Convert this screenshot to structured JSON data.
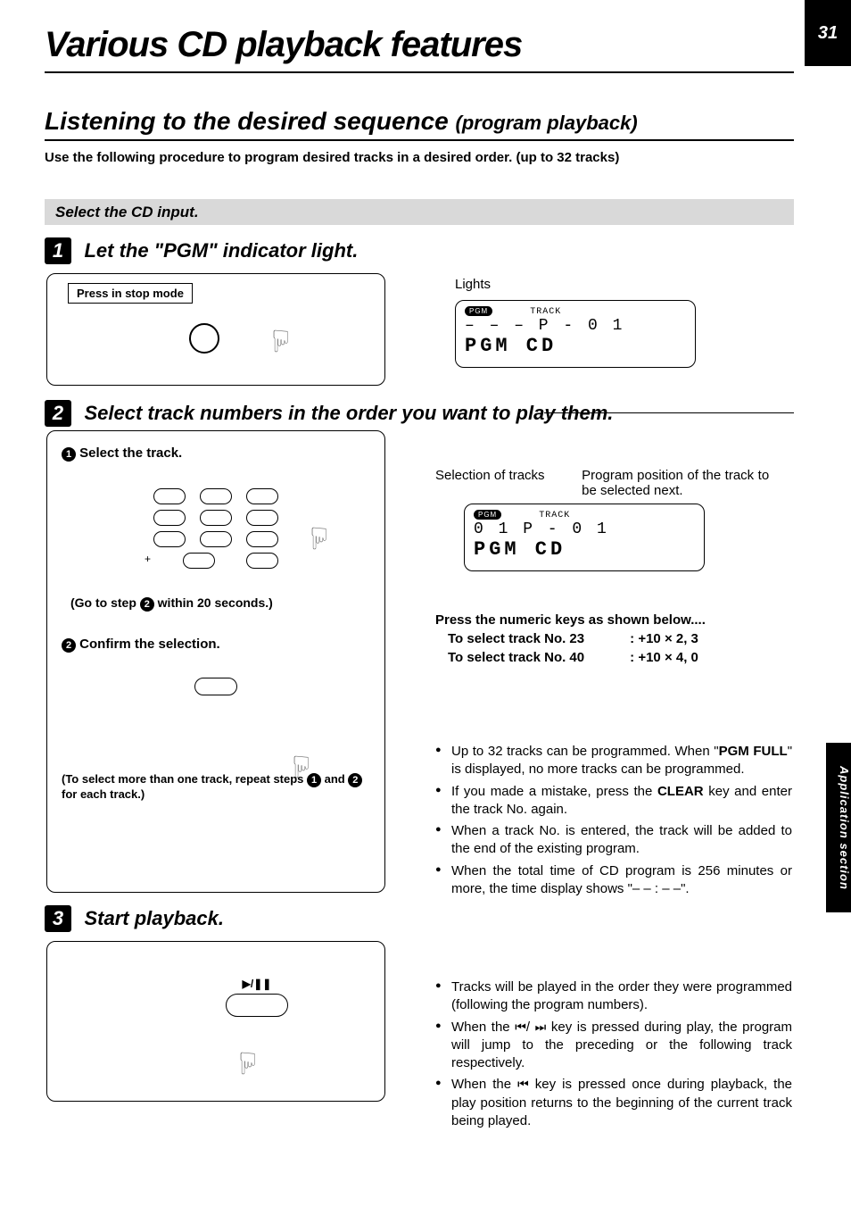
{
  "page_number": "31",
  "side_tab": "Application section",
  "page_title": "Various CD playback features",
  "section_title_main": "Listening to the desired sequence",
  "section_title_paren": "(program playback)",
  "intro": "Use the following procedure to program desired tracks in a desired order. (up to 32 tracks)",
  "gray_bar": "Select the CD input.",
  "step1": {
    "num": "1",
    "title": "Let  the \"PGM\" indicator light.",
    "press": "Press in stop mode",
    "lights": "Lights",
    "display": {
      "pgm": "PGM",
      "track_label": "TRACK",
      "line1": "– – –   P - 0 1",
      "line2": "PGM   CD"
    }
  },
  "step2": {
    "num": "2",
    "title": "Select track numbers in the order you want to play them.",
    "sub1_num": "1",
    "sub1": "Select the track.",
    "goto": "(Go to step        within 20 seconds.)",
    "goto_num": "2",
    "sub2_num": "2",
    "sub2": "Confirm the selection.",
    "repeat": "(To select more than one track, repeat steps       and       for each track.)",
    "repeat_n1": "1",
    "repeat_n2": "2",
    "right": {
      "sel": "Selection of tracks",
      "pos": "Program position of the track to be selected next.",
      "display": {
        "pgm": "PGM",
        "track_label": "TRACK",
        "line1": "  0 1   P - 0 1",
        "line2": "PGM   CD"
      }
    },
    "numeric": {
      "hdr": "Press the numeric keys as shown below....",
      "row1_lbl": "To select track No. 23",
      "row1_val": ": +10 × 2, 3",
      "row2_lbl": "To select track No. 40",
      "row2_val": ": +10 × 4, 0"
    },
    "bullets": [
      "Up to 32 tracks can be programmed. When \"PGM FULL\" is  displayed, no more tracks can be programmed.",
      "If you made a mistake, press the CLEAR key and enter the track No. again.",
      "When a track No. is entered, the track will be added  to the end of the existing program.",
      "When the total time of CD program is 256 minutes or more, the time display shows \"– – : – –\"."
    ],
    "bold_words": {
      "b0": "PGM FULL",
      "b1": "CLEAR"
    }
  },
  "step3": {
    "num": "3",
    "title": "Start playback.",
    "play_label": "▶/❚❚",
    "bullets": [
      "Tracks will be played in the order they were programmed (following the program numbers).",
      "When the ⏮/ ⏭ key is pressed during play, the program will jump to the preceding or the following track respectively.",
      "When the ⏮ key is pressed once during playback, the play position returns to the beginning of the current track being played."
    ]
  }
}
